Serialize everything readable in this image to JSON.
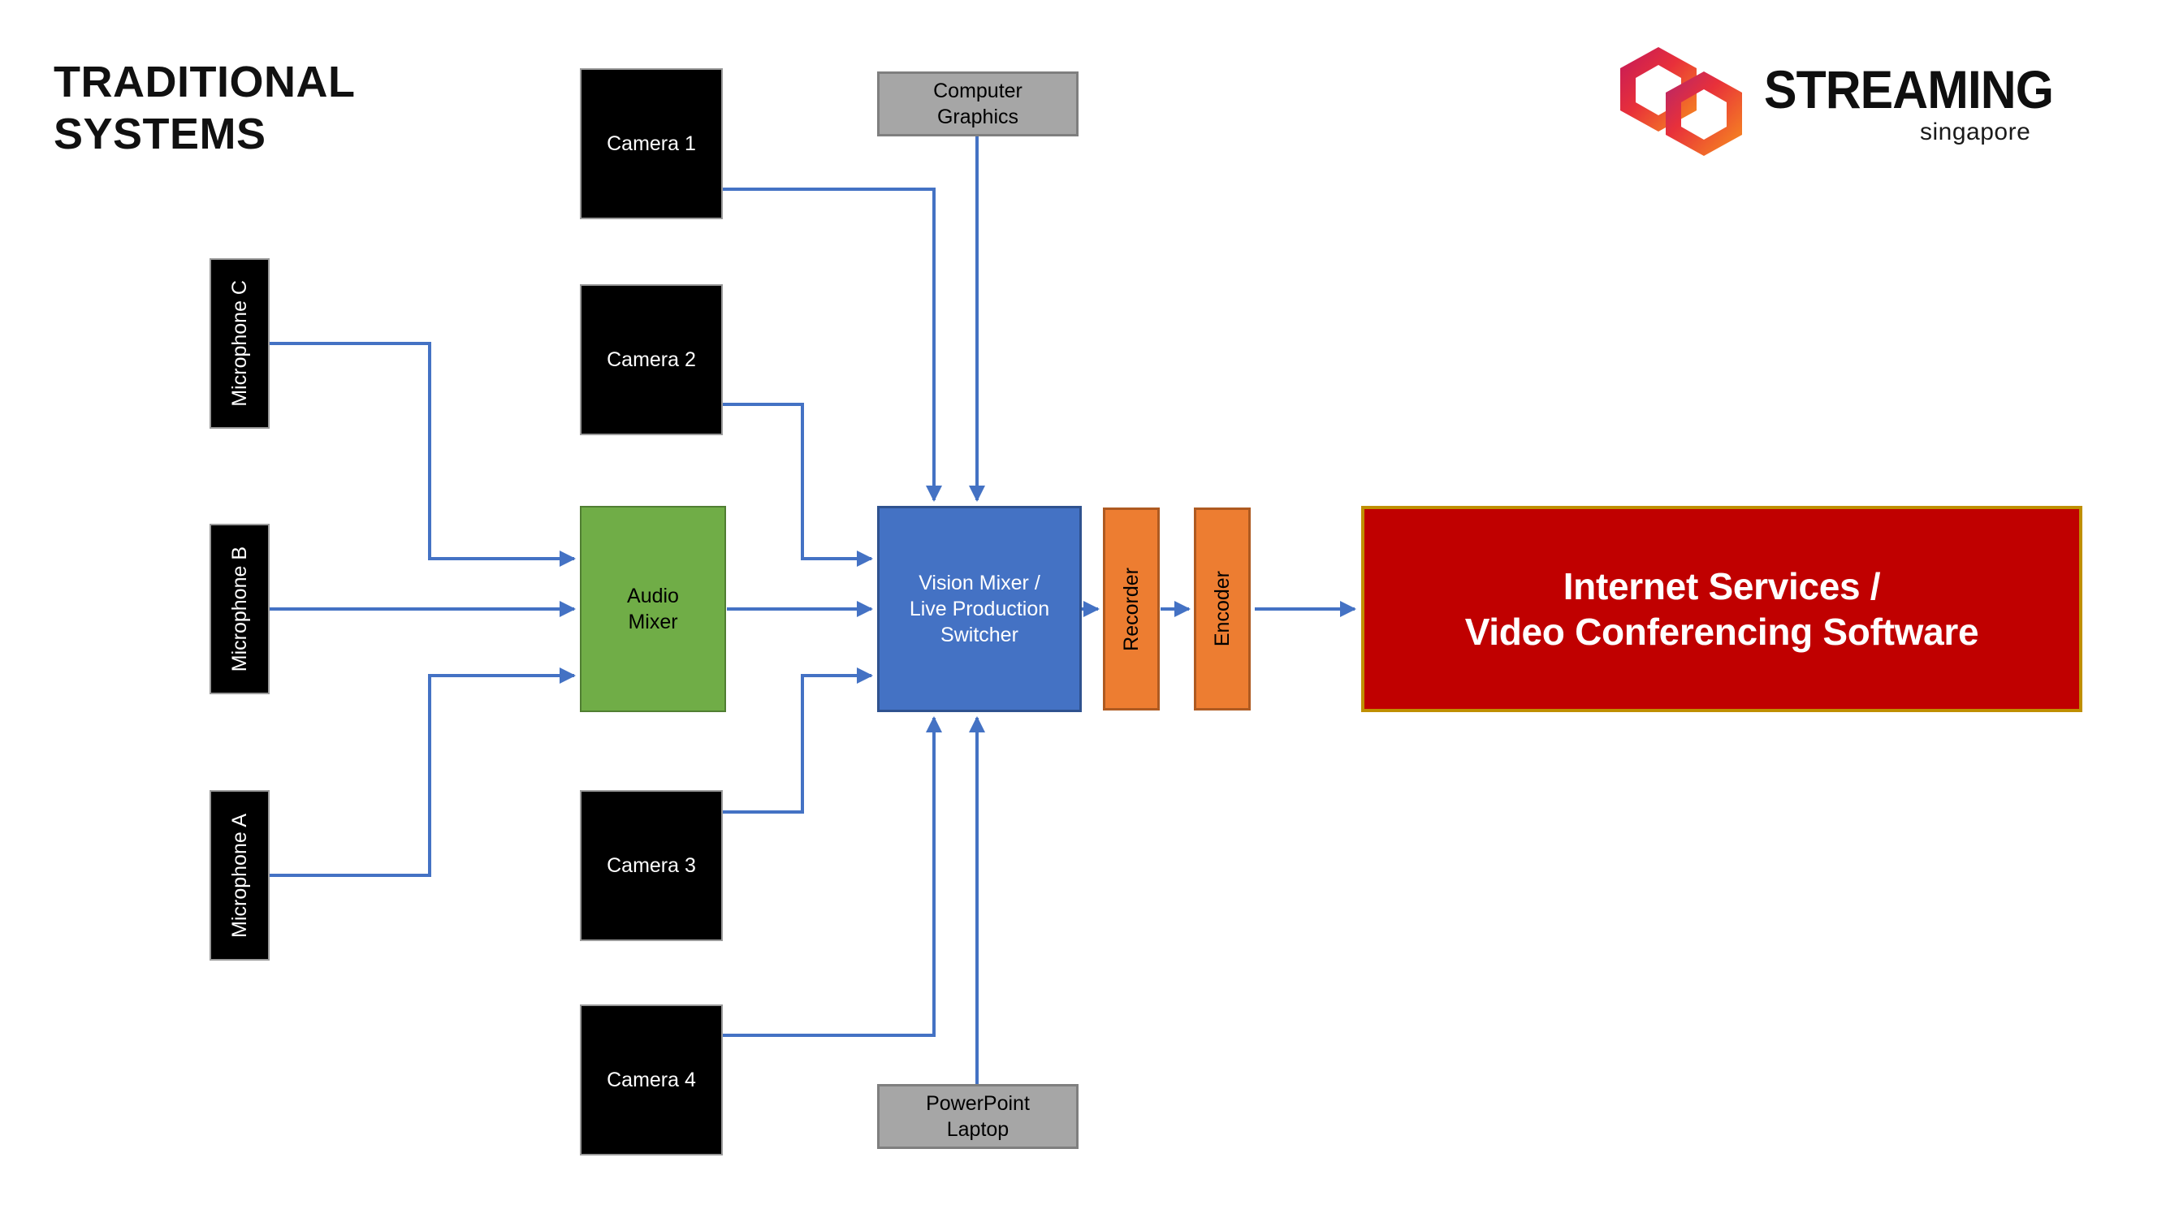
{
  "page": {
    "title": "TRADITIONAL\nSYSTEMS",
    "background_color": "#ffffff"
  },
  "brand": {
    "name": "STREAMING",
    "tagline": "singapore",
    "mark": "interlocking-hexagons",
    "gradient_from": "#C2185B",
    "gradient_mid": "#E8303A",
    "gradient_to": "#F7911E",
    "wordmark_color": "#0f0f0f"
  },
  "palette": {
    "camera_fill": "#000000",
    "camera_border": "#9a9a9a",
    "source_grey_fill": "#a6a6a6",
    "source_grey_border": "#7f7f7f",
    "audio_mixer_fill": "#70ad47",
    "audio_mixer_border": "#507e32",
    "vision_mixer_fill": "#4472c4",
    "vision_mixer_border": "#2f528f",
    "chain_fill": "#ed7d31",
    "chain_border": "#ae5a21",
    "destination_fill": "#c00000",
    "destination_border": "#bf8f00",
    "connector_color": "#4472c4"
  },
  "nodes": {
    "microphone_c": "Microphone C",
    "microphone_b": "Microphone B",
    "microphone_a": "Microphone A",
    "camera_1": "Camera 1",
    "camera_2": "Camera 2",
    "camera_3": "Camera 3",
    "camera_4": "Camera 4",
    "computer_graphics": "Computer\nGraphics",
    "powerpoint_laptop": "PowerPoint\nLaptop",
    "audio_mixer": "Audio\nMixer",
    "vision_mixer": "Vision Mixer /\nLive Production\nSwitcher",
    "recorder": "Recorder",
    "encoder": "Encoder",
    "destination": "Internet Services /\nVideo Conferencing Software"
  },
  "connections": [
    {
      "from": "microphone_c",
      "to": "audio_mixer",
      "style": "elbow-right-down"
    },
    {
      "from": "microphone_b",
      "to": "audio_mixer",
      "style": "straight"
    },
    {
      "from": "microphone_a",
      "to": "audio_mixer",
      "style": "elbow-right-up"
    },
    {
      "from": "camera_1",
      "to": "vision_mixer",
      "style": "elbow-right-down-top-entry"
    },
    {
      "from": "camera_2",
      "to": "vision_mixer",
      "style": "elbow-right-down-left-entry"
    },
    {
      "from": "computer_graphics",
      "to": "vision_mixer",
      "style": "straight-down-top-entry"
    },
    {
      "from": "audio_mixer",
      "to": "vision_mixer",
      "style": "straight"
    },
    {
      "from": "camera_3",
      "to": "vision_mixer",
      "style": "elbow-right-up-left-entry"
    },
    {
      "from": "camera_4",
      "to": "vision_mixer",
      "style": "elbow-right-up-bottom-entry"
    },
    {
      "from": "powerpoint_laptop",
      "to": "vision_mixer",
      "style": "straight-up-bottom-entry"
    },
    {
      "from": "vision_mixer",
      "to": "recorder",
      "style": "straight"
    },
    {
      "from": "recorder",
      "to": "encoder",
      "style": "straight"
    },
    {
      "from": "encoder",
      "to": "destination",
      "style": "straight"
    }
  ]
}
